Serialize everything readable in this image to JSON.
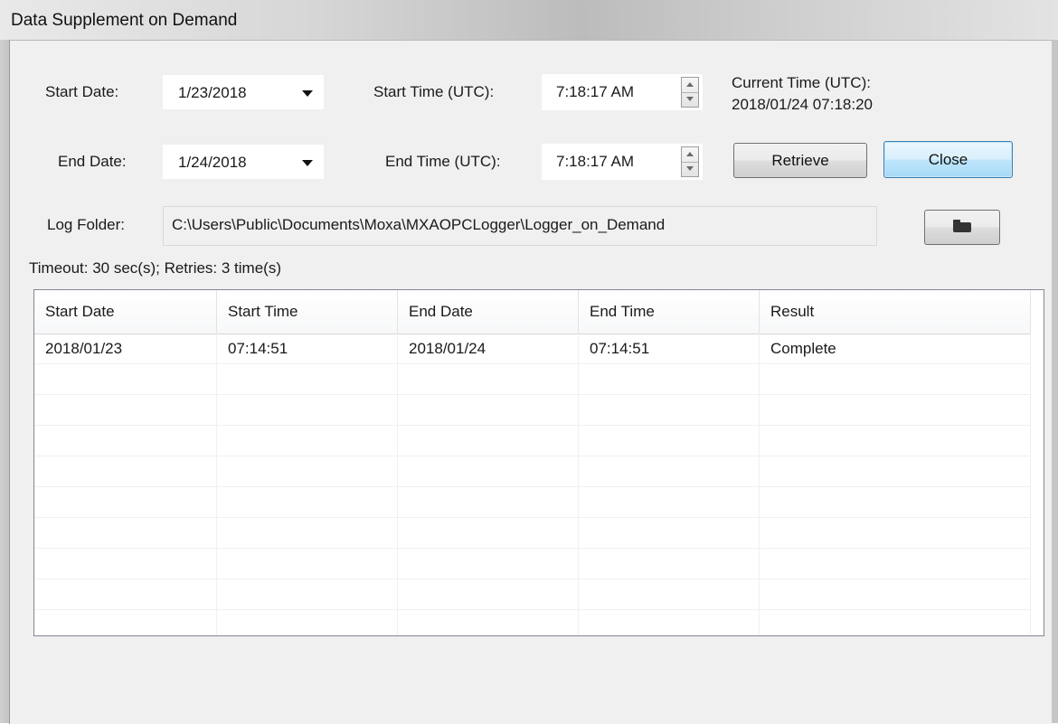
{
  "window": {
    "title": "Data Supplement on Demand"
  },
  "form": {
    "start_date_label": "Start Date:",
    "start_date_value": "1/23/2018",
    "end_date_label": "End Date:",
    "end_date_value": "1/24/2018",
    "start_time_label": "Start Time (UTC):",
    "start_time_value": "7:18:17 AM",
    "end_time_label": "End Time (UTC):",
    "end_time_value": "7:18:17 AM",
    "current_time_label": "Current Time (UTC):",
    "current_time_value": "2018/01/24 07:18:20",
    "log_folder_label": "Log Folder:",
    "log_folder_value": "C:\\Users\\Public\\Documents\\Moxa\\MXAOPCLogger\\Logger_on_Demand",
    "timeout_text": "Timeout: 30 sec(s); Retries: 3 time(s)"
  },
  "buttons": {
    "retrieve_label": "Retrieve",
    "close_label": "Close",
    "browse_icon": "folder-icon"
  },
  "table": {
    "columns": [
      "Start Date",
      "Start Time",
      "End Date",
      "End Time",
      "Result"
    ],
    "rows": [
      [
        "2018/01/23",
        "07:14:51",
        "2018/01/24",
        "07:14:51",
        "Complete"
      ]
    ]
  }
}
